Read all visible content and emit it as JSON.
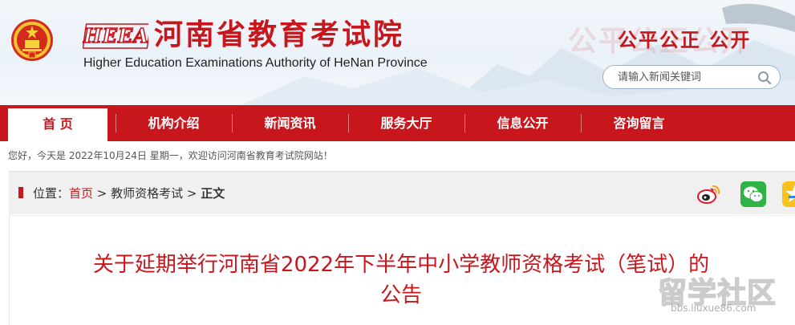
{
  "header": {
    "logo_text": "HEEA",
    "title": "河南省教育考试院",
    "subtitle": "Higher Education Examinations Authority of HeNan Province",
    "slogan_bg": "公平公正公开",
    "slogan": "公平公正 公开"
  },
  "search": {
    "placeholder": "请输入新闻关键词"
  },
  "nav": {
    "items": [
      {
        "label": "首 页"
      },
      {
        "label": "机构介绍"
      },
      {
        "label": "新闻资讯"
      },
      {
        "label": "服务大厅"
      },
      {
        "label": "信息公开"
      },
      {
        "label": "咨询留言"
      }
    ]
  },
  "welcome": "您好，今天是 2022年10月24日 星期一，欢迎访问河南省教育考试院网站！",
  "breadcrumb": {
    "prefix": "位置：",
    "home": "首页",
    "sep1": " > ",
    "section": "教师资格考试",
    "sep2": " > ",
    "current": "正文"
  },
  "article": {
    "title_line1": "关于延期举行河南省2022年下半年中小学教师资格考试（笔试）的",
    "title_line2": "公告"
  },
  "watermark": {
    "text": "留学社区",
    "url": "bbs.liuxue86.com"
  },
  "icons": {
    "emblem": "national-emblem-icon",
    "search": "search-icon",
    "weibo": "weibo-icon",
    "wechat": "wechat-icon",
    "qzone": "qzone-icon"
  },
  "colors": {
    "brand_red": "#c8161d"
  }
}
